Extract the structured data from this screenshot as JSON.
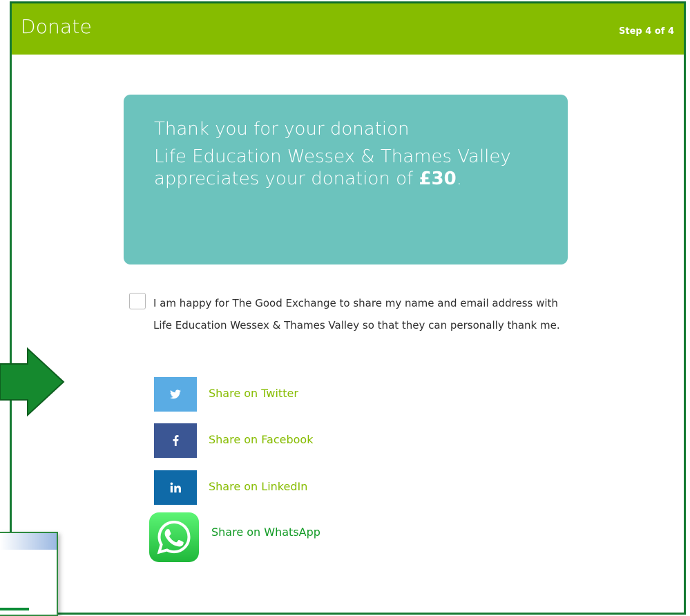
{
  "header": {
    "title": "Donate",
    "step": "Step 4 of 4",
    "color": "#86bc00"
  },
  "thanks": {
    "line1": "Thank you for your donation",
    "body": "Life Education Wessex & Thames Valley appreciates your donation of",
    "amount": "£30",
    "suffix": ".",
    "color": "#6cc3bd"
  },
  "consent": {
    "text": "I am happy for The Good Exchange to share my name and email address with Life Education Wessex & Thames Valley so that they can personally thank me.",
    "checked": false
  },
  "share": {
    "twitter": {
      "label": "Share on Twitter",
      "color": "#5aace4",
      "icon": "twitter-icon"
    },
    "facebook": {
      "label": "Share on Facebook",
      "color": "#3b5694",
      "icon": "facebook-icon"
    },
    "linkedin": {
      "label": "Share on LinkedIn",
      "color": "#0f6aa8",
      "icon": "linkedin-icon"
    },
    "whatsapp": {
      "label": "Share on WhatsApp",
      "color": "#25d366",
      "icon": "whatsapp-icon"
    }
  },
  "annotation": {
    "color": "#15892e",
    "icon": "right-arrow-icon"
  }
}
